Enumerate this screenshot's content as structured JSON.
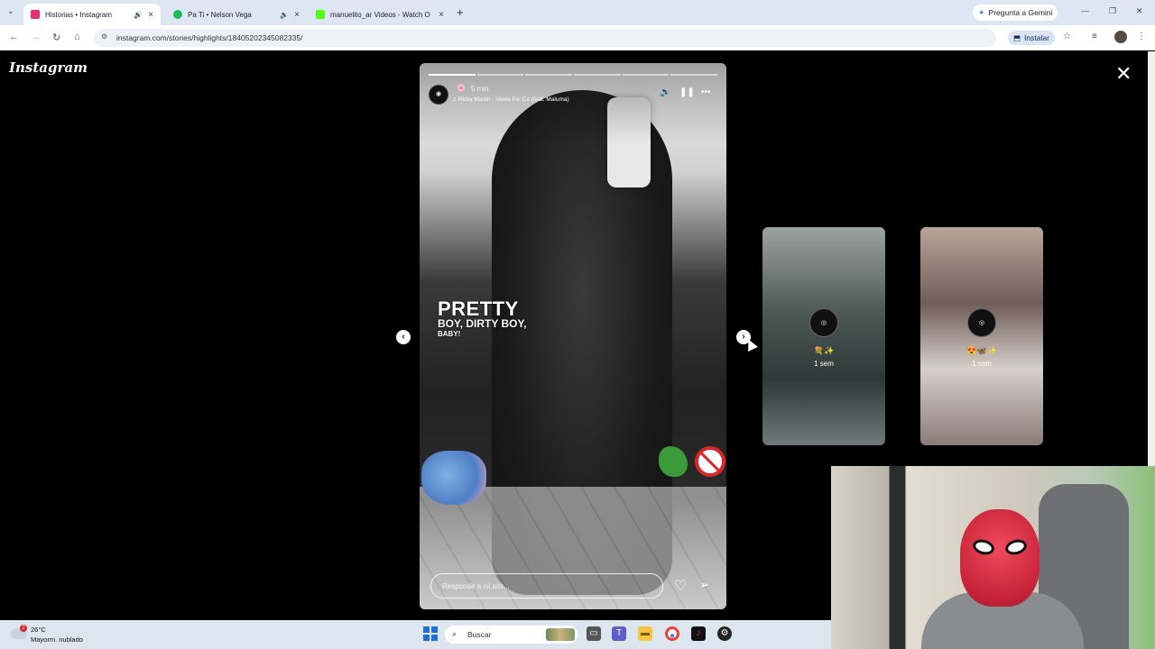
{
  "browser": {
    "tabs": [
      {
        "title": "Historias • Instagram",
        "fav_color": "#e1306c",
        "active": true
      },
      {
        "title": "Pa Ti • Nelson Vega",
        "fav_color": "#1db954",
        "active": false
      },
      {
        "title": "manuelito_ar Videos - Watch O",
        "fav_color": "#53fc18",
        "active": false
      }
    ],
    "gemini_label": "Pregunta a Gemini",
    "url": "instagram.com/stories/highlights/18405202345082335/",
    "install_label": "Instalar"
  },
  "instagram": {
    "logo": "Instagram",
    "story": {
      "username": "",
      "time": "5 min",
      "music": "Ricky Martin - Vente Pa' Ca (feat. Maluma)",
      "text_line1": "PRETTY",
      "text_line2": "BOY, DIRTY BOY,",
      "text_line3": "BABY!",
      "reply_placeholder": "Responde a nii.aits...",
      "progress_segments": 6,
      "progress_done": 1
    },
    "previews": [
      {
        "name": "💐✨",
        "time": "1 sem"
      },
      {
        "name": "😍🦋✨",
        "time": "1 sem"
      }
    ]
  },
  "taskbar": {
    "weather_temp": "26°C",
    "weather_desc": "Mayorm. nublado",
    "weather_badge": "2",
    "search_label": "Buscar"
  }
}
